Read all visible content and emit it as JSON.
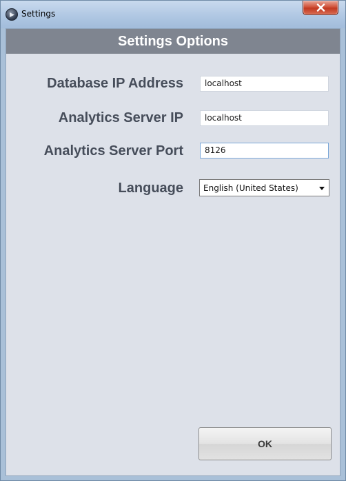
{
  "window": {
    "title": "Settings",
    "app_icon": "app-logo-icon",
    "close_icon": "close-icon"
  },
  "header": {
    "title": "Settings Options"
  },
  "form": {
    "database_ip": {
      "label": "Database IP Address",
      "value": "localhost"
    },
    "analytics_server_ip": {
      "label": "Analytics Server IP",
      "value": "localhost"
    },
    "analytics_server_port": {
      "label": "Analytics Server Port",
      "value": "8126"
    },
    "language": {
      "label": "Language",
      "selected": "English (United States)"
    }
  },
  "actions": {
    "ok_label": "OK"
  },
  "colors": {
    "header_bar": "#7f8590",
    "label_text": "#464d5a",
    "client_background": "#dde1e9",
    "close_button": "#c94a32"
  }
}
